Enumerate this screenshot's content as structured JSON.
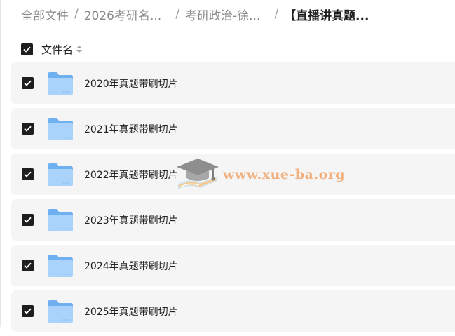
{
  "breadcrumb": {
    "items": [
      "全部文件",
      "2026考研名...",
      "考研政治-徐...",
      "【直播讲真题..."
    ]
  },
  "header": {
    "column_label": "文件名",
    "sort_icon": "sort-icon"
  },
  "files": [
    {
      "name": "2020年真题带刷切片",
      "checked": true,
      "icon": "folder-icon"
    },
    {
      "name": "2021年真题带刷切片",
      "checked": true,
      "icon": "folder-icon"
    },
    {
      "name": "2022年真题带刷切片",
      "checked": true,
      "icon": "folder-icon"
    },
    {
      "name": "2023年真题带刷切片",
      "checked": true,
      "icon": "folder-icon"
    },
    {
      "name": "2024年真题带刷切片",
      "checked": true,
      "icon": "folder-icon"
    },
    {
      "name": "2025年真题带刷切片",
      "checked": true,
      "icon": "folder-icon"
    }
  ],
  "watermark": {
    "text": "www.xue-ba.org",
    "icon": "graduation-cap-icon"
  },
  "colors": {
    "row_bg": "#f5f5f5",
    "checkbox": "#1e1e1e",
    "folder_light": "#a9d3fb",
    "folder_dark": "#6fb0f0",
    "watermark": "#f1a56a"
  }
}
